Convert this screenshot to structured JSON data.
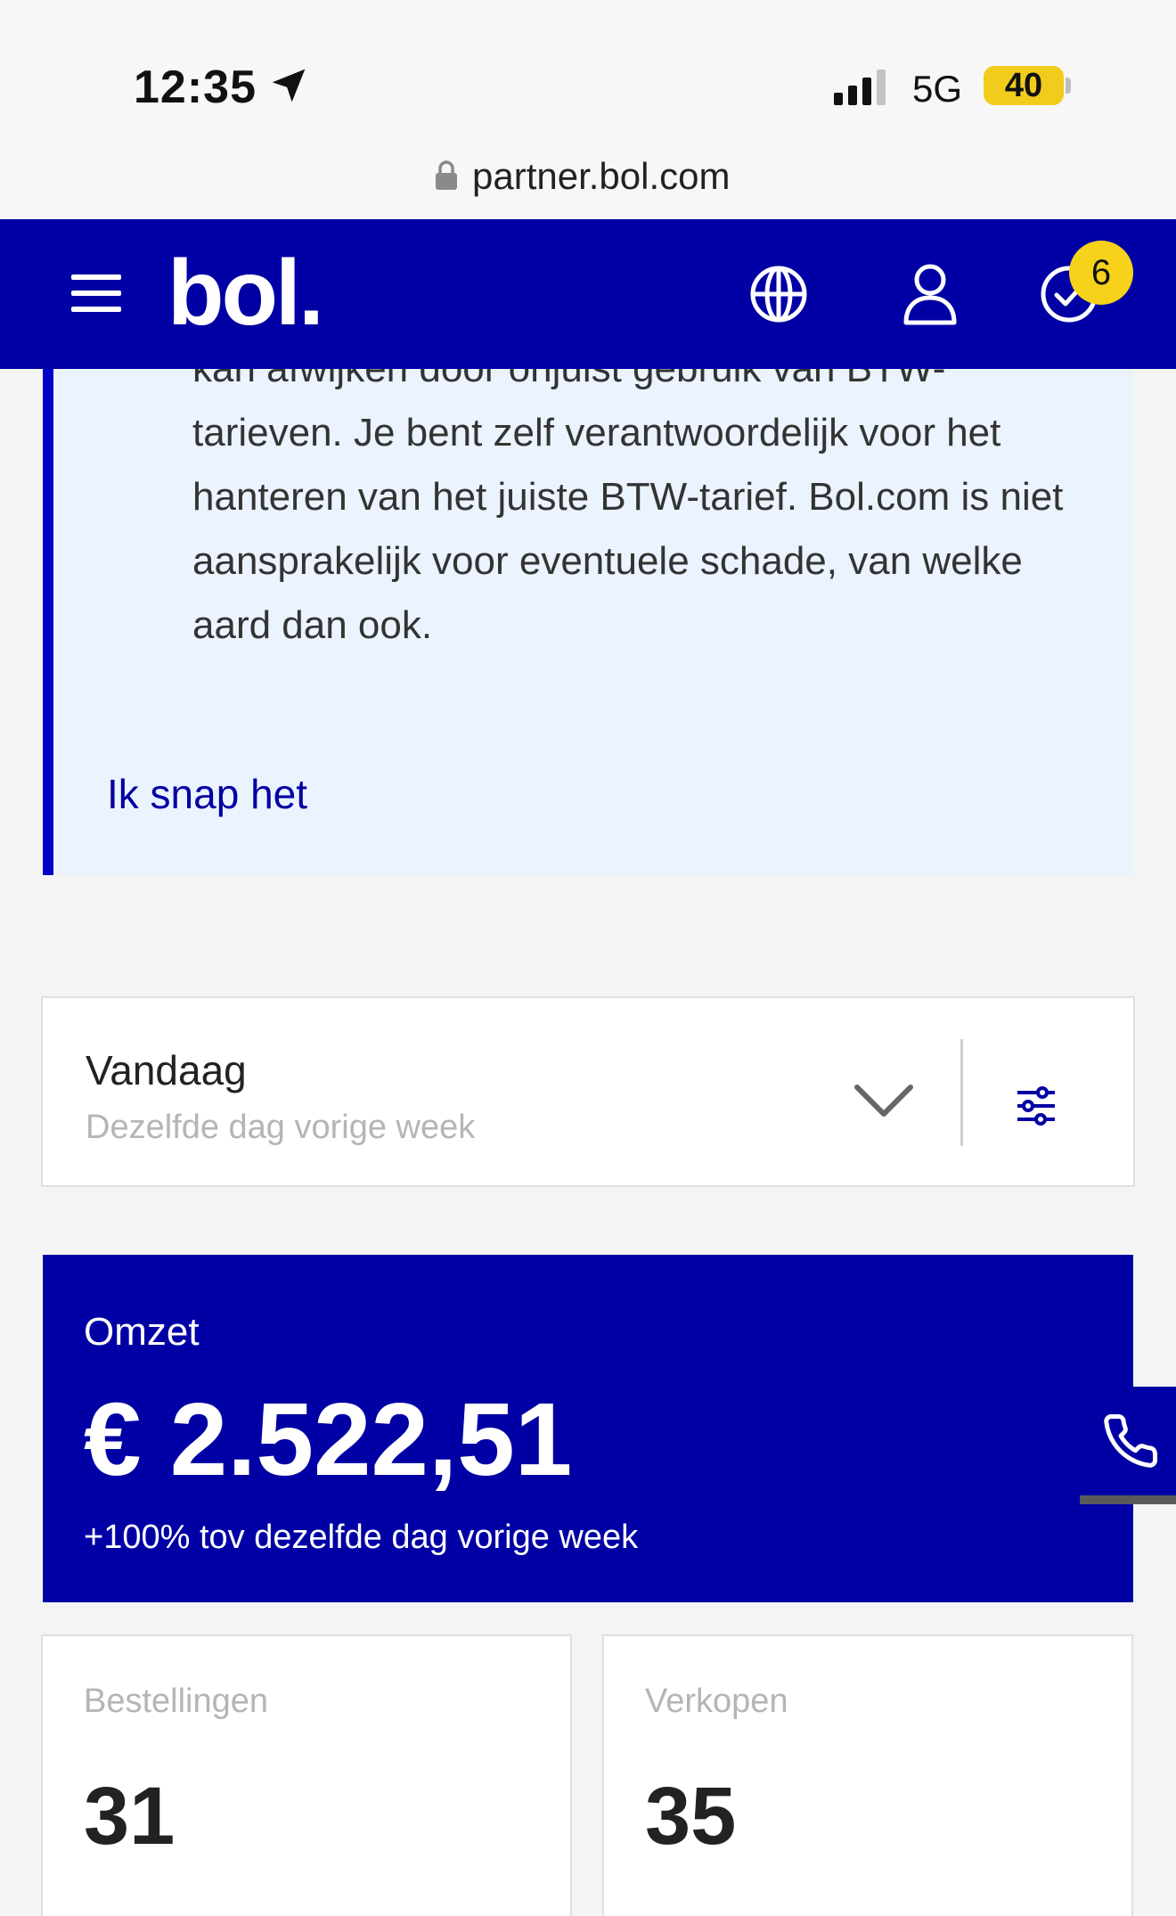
{
  "status_bar": {
    "time": "12:35",
    "network": "5G",
    "battery": "40"
  },
  "browser": {
    "url": "partner.bol.com"
  },
  "header": {
    "logo": "bol.",
    "notification_count": "6"
  },
  "notice": {
    "text": "kan afwijken door onjuist gebruik van BTW-tarieven. Je bent zelf verantwoordelijk voor het hanteren van het juiste BTW-tarief. Bol.com is niet aansprakelijk voor eventuele schade, van welke aard dan ook.",
    "link": "Ik snap het"
  },
  "period": {
    "label": "Vandaag",
    "compare": "Dezelfde dag vorige week"
  },
  "revenue": {
    "label": "Omzet",
    "value": "€ 2.522,51",
    "delta": "+100% tov dezelfde dag vorige week"
  },
  "stats": [
    {
      "label": "Bestellingen",
      "value": "31"
    },
    {
      "label": "Verkopen",
      "value": "35"
    }
  ]
}
